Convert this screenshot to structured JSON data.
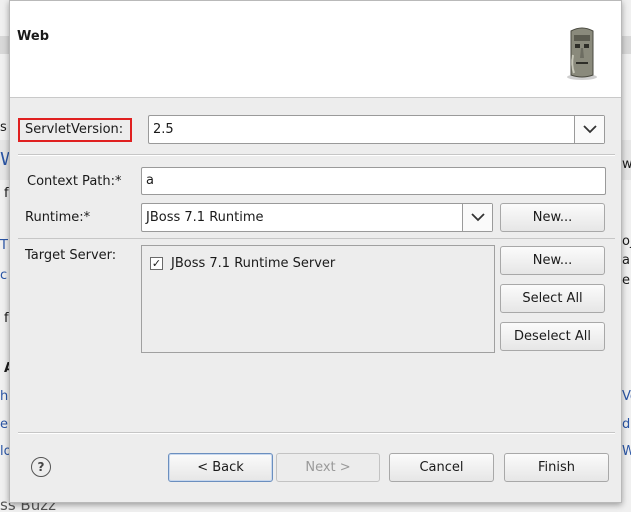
{
  "background": {
    "left_fragments": [
      "s",
      "We",
      "f",
      "T",
      "c",
      "f",
      "A",
      "h",
      "e",
      "lo",
      "ss Buzz"
    ],
    "right_fragments": [
      "w",
      "oj",
      "an",
      "en",
      "Vo",
      "d",
      "W"
    ]
  },
  "banner": {
    "title": "Web",
    "icon": "moai-statue-icon"
  },
  "servlet": {
    "label": "ServletVersion:",
    "value": "2.5"
  },
  "context_path": {
    "label": "Context Path:*",
    "value": "a"
  },
  "runtime": {
    "label": "Runtime:*",
    "value": "JBoss 7.1 Runtime",
    "new_label": "New..."
  },
  "target_server": {
    "label": "Target Server:",
    "items": [
      {
        "label": "JBoss 7.1 Runtime Server",
        "checked": "✓"
      }
    ],
    "new_label": "New...",
    "select_all_label": "Select All",
    "deselect_all_label": "Deselect All"
  },
  "footer": {
    "help_icon": "help-icon",
    "help_glyph": "?",
    "back_label": "< Back",
    "next_label": "Next >",
    "cancel_label": "Cancel",
    "finish_label": "Finish"
  },
  "colors": {
    "highlight_border": "#e02020",
    "link": "#2a55a5"
  }
}
